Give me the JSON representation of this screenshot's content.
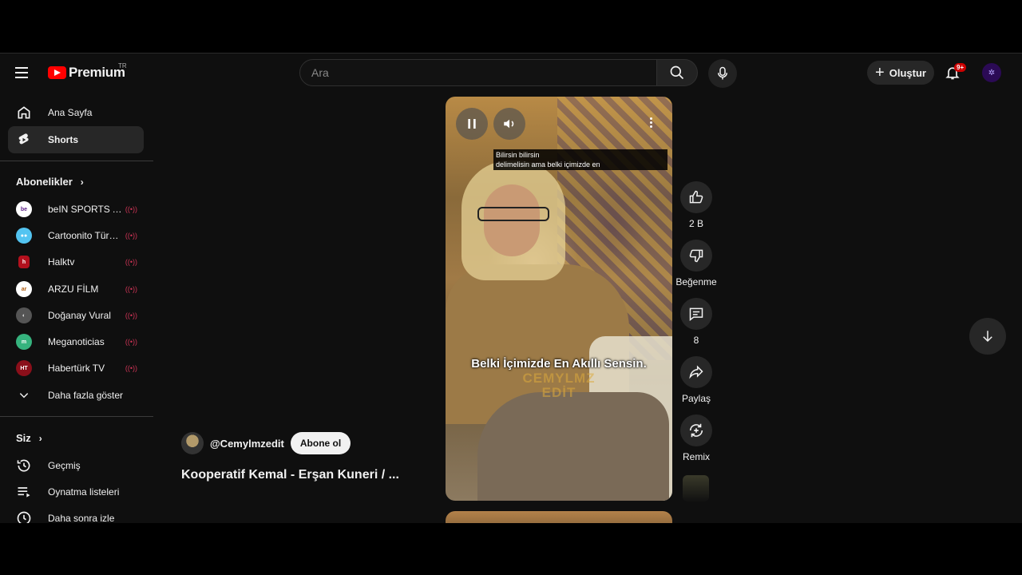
{
  "header": {
    "logo_text": "Premium",
    "country_code": "TR",
    "search_placeholder": "Ara",
    "create_label": "Oluştur",
    "notification_badge": "9+"
  },
  "sidebar": {
    "main_items": [
      {
        "label": "Ana Sayfa",
        "icon": "home-icon"
      },
      {
        "label": "Shorts",
        "icon": "shorts-icon",
        "active": true
      }
    ],
    "subscriptions_title": "Abonelikler",
    "subscriptions": [
      {
        "name": "beIN SPORTS Ar...",
        "color": "#ffffff",
        "live": true
      },
      {
        "name": "Cartoonito Türkiye",
        "color": "#53c4f1",
        "live": true
      },
      {
        "name": "Halktv",
        "color": "#b3101d",
        "live": true
      },
      {
        "name": "ARZU FİLM",
        "color": "#ffffff",
        "live": true
      },
      {
        "name": "Doğanay Vural",
        "color": "#555555",
        "live": true
      },
      {
        "name": "Meganoticias",
        "color": "#36b37e",
        "live": true
      },
      {
        "name": "Habertürk TV",
        "color": "#8a0f1a",
        "live": true
      }
    ],
    "show_more": "Daha fazla göster",
    "you_title": "Siz",
    "you_items": [
      {
        "label": "Geçmiş",
        "icon": "history-icon"
      },
      {
        "label": "Oynatma listeleri",
        "icon": "playlists-icon"
      },
      {
        "label": "Daha sonra izle",
        "icon": "watch-later-icon"
      }
    ]
  },
  "video": {
    "caption_line1": "Bilirsin bilirsin",
    "caption_line2": "delimelisin ama belki içimizde en",
    "subtitle": "Belki İçimizde En Akıllı Sensin.",
    "watermark_line1": "CEMYLMZ",
    "watermark_line2": "EDİT"
  },
  "actions": {
    "like_count": "2 B",
    "dislike_label": "Beğenme",
    "comment_count": "8",
    "share_label": "Paylaş",
    "remix_label": "Remix"
  },
  "info": {
    "channel": "@Cemylmzedit",
    "subscribe_label": "Abone ol",
    "title": "Kooperatif Kemal - Erşan Kuneri / ..."
  }
}
